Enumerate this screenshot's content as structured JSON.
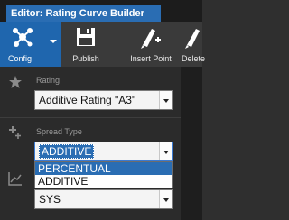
{
  "window": {
    "title": "Editor: Rating Curve Builder"
  },
  "toolbar": {
    "config_label": "Config",
    "publish_label": "Publish",
    "insert_point_label": "Insert Point",
    "delete_label": "Delete"
  },
  "form": {
    "rating": {
      "label": "Rating",
      "value": "Additive Rating \"A3\""
    },
    "spread_type": {
      "label": "Spread Type",
      "value": "ADDITIVE",
      "options": [
        "PERCENTUAL",
        "ADDITIVE"
      ],
      "highlighted": "PERCENTUAL"
    },
    "third": {
      "value": "SYS"
    }
  },
  "colors": {
    "accent": "#2a6db3",
    "toolbar_bg": "#3a3a3a",
    "panel_bg": "#2b2b2b"
  },
  "icons": [
    "config-icon",
    "publish-icon",
    "insert-point-icon",
    "delete-icon",
    "star-icon",
    "spread-icon",
    "chart-icon"
  ]
}
